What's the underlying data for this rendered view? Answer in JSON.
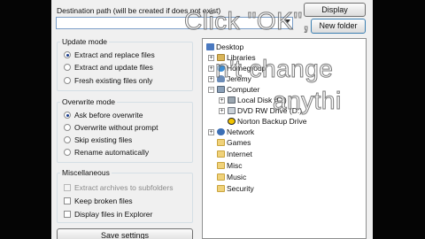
{
  "destination": {
    "label": "Destination path (will be created if does not exist)",
    "value": ""
  },
  "buttons": {
    "display": "Display",
    "new_folder": "New folder",
    "save_settings": "Save settings"
  },
  "update_mode": {
    "title": "Update mode",
    "options": [
      {
        "label": "Extract and replace files",
        "selected": true
      },
      {
        "label": "Extract and update files",
        "selected": false
      },
      {
        "label": "Fresh existing files only",
        "selected": false
      }
    ]
  },
  "overwrite_mode": {
    "title": "Overwrite mode",
    "options": [
      {
        "label": "Ask before overwrite",
        "selected": true
      },
      {
        "label": "Overwrite without prompt",
        "selected": false
      },
      {
        "label": "Skip existing files",
        "selected": false
      },
      {
        "label": "Rename automatically",
        "selected": false
      }
    ]
  },
  "miscellaneous": {
    "title": "Miscellaneous",
    "options": [
      {
        "label": "Extract archives to subfolders",
        "checked": false,
        "enabled": false
      },
      {
        "label": "Keep broken files",
        "checked": false,
        "enabled": true
      },
      {
        "label": "Display files in Explorer",
        "checked": false,
        "enabled": true
      }
    ]
  },
  "tree": {
    "items": [
      {
        "label": "Desktop",
        "icon": "desktop-icon"
      },
      {
        "label": "Libraries",
        "icon": "library-icon"
      },
      {
        "label": "Homegroup",
        "icon": "homegroup-icon"
      },
      {
        "label": "Jeremy",
        "icon": "user-icon"
      },
      {
        "label": "Computer",
        "icon": "computer-icon"
      },
      {
        "label": "Local Disk (C:)",
        "icon": "disk-icon"
      },
      {
        "label": "DVD RW Drive (D:)",
        "icon": "dvd-icon"
      },
      {
        "label": "Norton Backup Drive",
        "icon": "norton-icon"
      },
      {
        "label": "Network",
        "icon": "network-icon"
      },
      {
        "label": "Games",
        "icon": "folder-icon"
      },
      {
        "label": "Internet",
        "icon": "folder-icon"
      },
      {
        "label": "Misc",
        "icon": "folder-icon"
      },
      {
        "label": "Music",
        "icon": "folder-icon"
      },
      {
        "label": "Security",
        "icon": "folder-icon"
      }
    ]
  },
  "overlay_text": {
    "line1": "Click \"OK\",",
    "line2": "n't change",
    "line3": "anythi"
  }
}
